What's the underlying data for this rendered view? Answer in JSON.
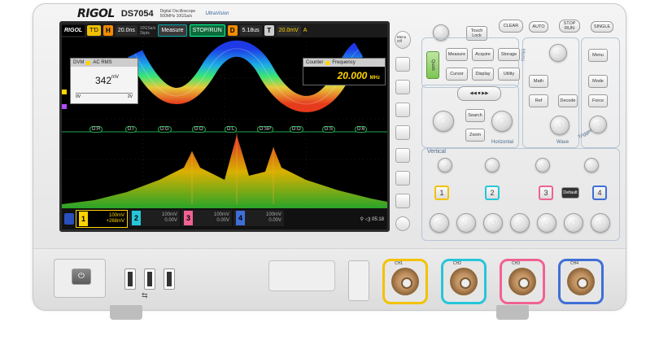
{
  "brand": {
    "name": "RIGOL",
    "model": "DS7054",
    "subtitle_line1": "Digital Oscilloscope",
    "subtitle_line2": "500MHz 10GSa/s",
    "series": "UltraVision"
  },
  "screen": {
    "topbar": {
      "horizontal_letter": "H",
      "timebase": "20.0ns",
      "sample_rate": "10GSa/s",
      "memory_depth": "2kpts",
      "measure_label": "Measure",
      "run_state": "STOP/RUN",
      "delay_letter": "D",
      "delay_value": "5.18us",
      "trigger_letter": "T",
      "trigger_level": "20.0mV",
      "trigger_source": "A",
      "rigol_label": "RIGOL",
      "td_label": "T'D"
    },
    "dvm": {
      "title": "DVM",
      "mode": "AC RMS",
      "value": "342",
      "unit": "mV",
      "scale_min": "0V",
      "scale_max": "2V"
    },
    "counter": {
      "title": "Counter",
      "mode": "Frequency",
      "value": "20.000",
      "unit": "MHz"
    },
    "bus_labels": [
      "D:R",
      "D:I",
      "D:G",
      "D:O",
      "D:L",
      "D:SP",
      "D:O",
      "D:S",
      "D:6"
    ],
    "channels": [
      {
        "num": "1",
        "scale": "100mV",
        "offset": "+268mV",
        "color": "#ffd400"
      },
      {
        "num": "2",
        "scale": "100mV",
        "offset": "0.00V",
        "color": "#26c6da"
      },
      {
        "num": "3",
        "scale": "100mV",
        "offset": "0.00V",
        "color": "#f06292"
      },
      {
        "num": "4",
        "scale": "100mV",
        "offset": "0.00V",
        "color": "#3f6fd6"
      }
    ],
    "time": "05:18"
  },
  "sidebuttons": {
    "menu_label": "Menu",
    "menu_label2": "Off"
  },
  "panel": {
    "touch_lock": "Touch Lock",
    "clear": "CLEAR",
    "auto": "AUTO",
    "stop_run": "STOP RUN",
    "single": "SINGLE",
    "quick": "Quick",
    "measure": "Measure",
    "acquire": "Acquire",
    "storage": "Storage",
    "cursor": "Cursor",
    "display": "Display",
    "utility": "Utility",
    "math": "Math",
    "ref": "Ref",
    "decode": "Decode",
    "search": "Search",
    "zoom": "Zoom",
    "horizontal": "Horizontal",
    "menu_section": "Menu",
    "wave": "Wave",
    "trigger": "Trigger",
    "menu": "Menu",
    "mode": "Mode",
    "force": "Force",
    "vertical": "Vertical",
    "default": "Default",
    "ch_buttons": [
      "1",
      "2",
      "3",
      "4"
    ]
  },
  "inputs": {
    "ch_labels": [
      "CH1",
      "CH2",
      "CH3",
      "CH4"
    ]
  }
}
